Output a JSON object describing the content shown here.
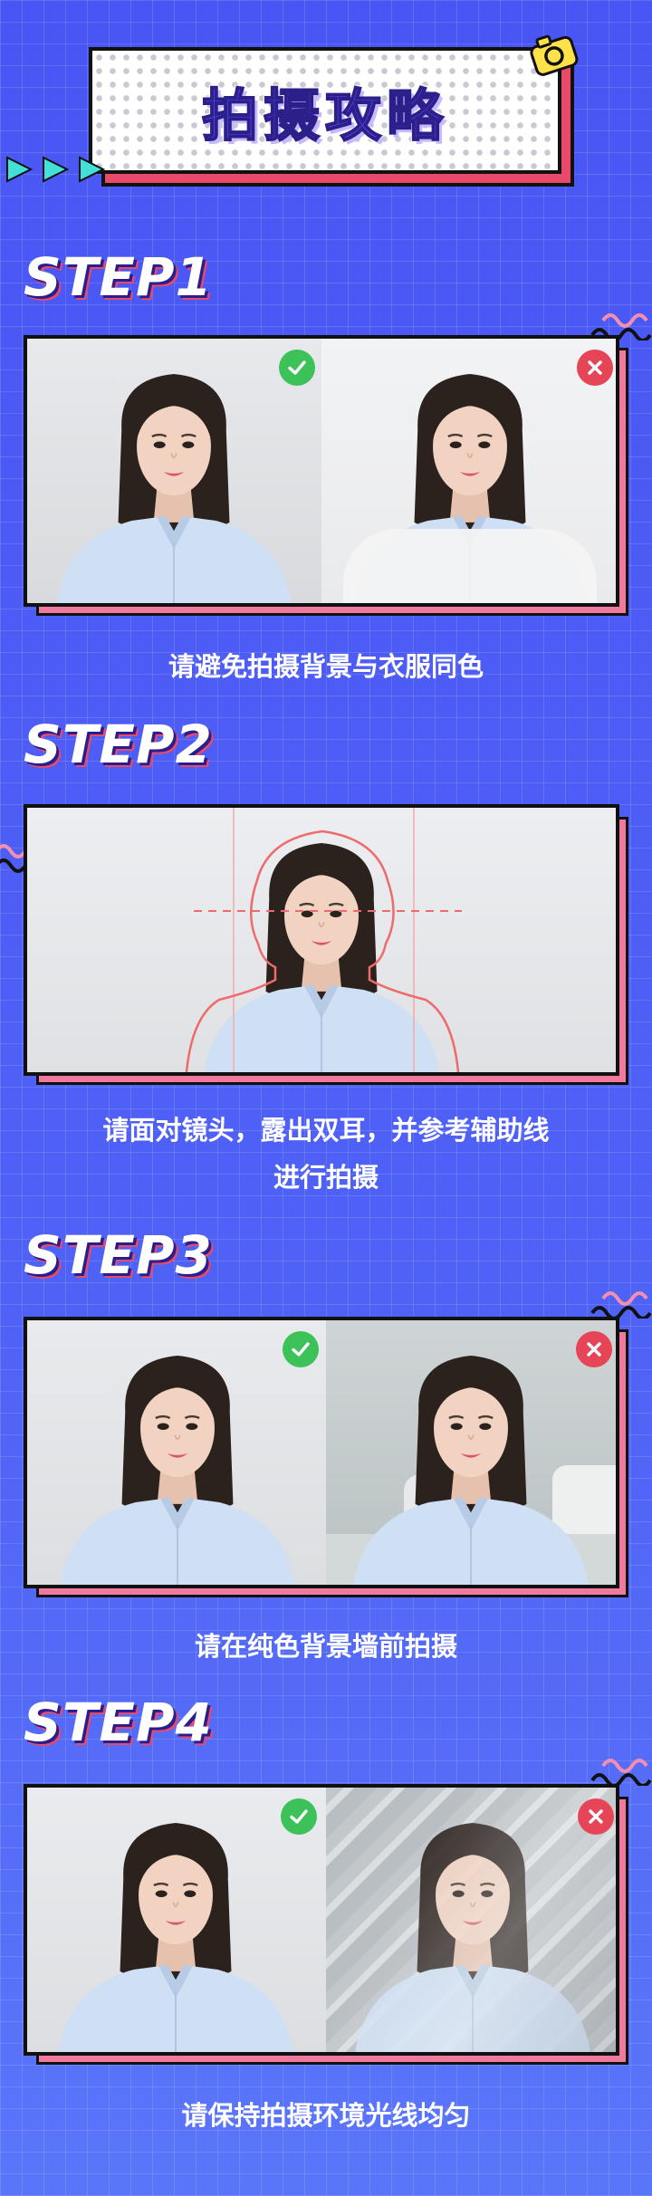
{
  "header": {
    "title": "拍摄攻略"
  },
  "steps": [
    {
      "label": "STEP1",
      "caption_lines": [
        "请避免拍摄背景与衣服同色"
      ]
    },
    {
      "label": "STEP2",
      "caption_lines": [
        "请面对镜头，露出双耳，并参考辅助线",
        "进行拍摄"
      ]
    },
    {
      "label": "STEP3",
      "caption_lines": [
        "请在纯色背景墙前拍摄"
      ]
    },
    {
      "label": "STEP4",
      "caption_lines": [
        "请保持拍摄环境光线均匀"
      ]
    }
  ],
  "icons": {
    "correct": "check-circle-icon",
    "wrong": "cross-circle-icon",
    "camera": "camera-icon",
    "arrows": "play-arrows-icon"
  },
  "colors": {
    "background": "#4f5ef5",
    "accent_pink": "#f07a9e",
    "title_purple": "#5a45f0",
    "ok_green": "#3dc25a",
    "no_red": "#e64558"
  }
}
